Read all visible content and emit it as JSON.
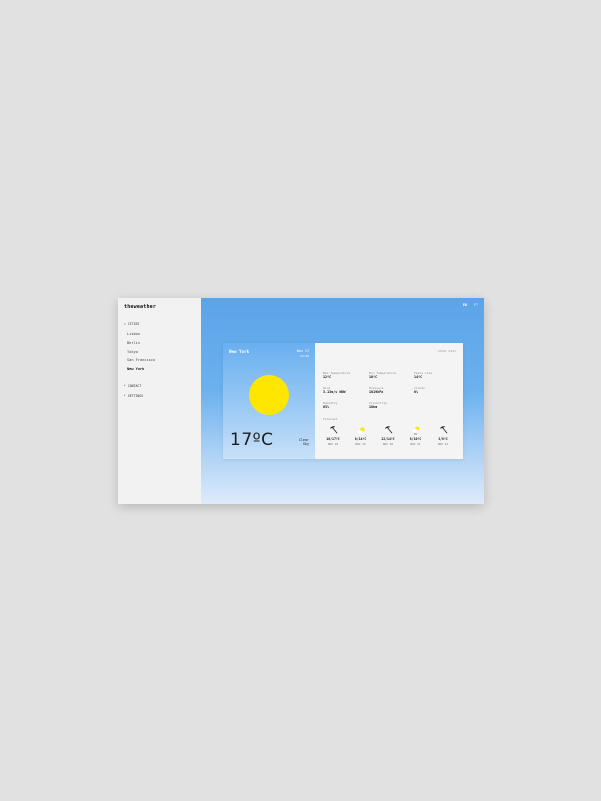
{
  "app": {
    "brand": "theweather"
  },
  "sidebar": {
    "sections": {
      "cities": "CITIES",
      "contact": "CONTACT",
      "settings": "SETTINGS"
    },
    "cities": [
      "Lisbon",
      "Berlin",
      "Tokyo",
      "San Francisco",
      "New York"
    ],
    "active_city": "New York"
  },
  "top_controls": {
    "option1": "EN",
    "option2": "PT"
  },
  "current": {
    "location": "New York",
    "date": "Nov 17",
    "time": "13:46",
    "temperature": "17ºC",
    "description_line1": "Clear",
    "description_line2": "Sky",
    "icon": "sun-icon"
  },
  "details": {
    "units_toggle": "SHOW UNIT",
    "stats": [
      {
        "label": "Max Temperature",
        "value": "12ºC"
      },
      {
        "label": "Min Temperature",
        "value": "10ºC"
      },
      {
        "label": "Feels Like",
        "value": "14ºC"
      },
      {
        "label": "Wind",
        "value": "3.13m/s NNW"
      },
      {
        "label": "Pressure",
        "value": "1019hPa"
      },
      {
        "label": "Clouds",
        "value": "0%"
      },
      {
        "label": "Humidity",
        "value": "63%"
      },
      {
        "label": "Visibility",
        "value": "10km"
      }
    ],
    "forecast_label": "Forecast",
    "forecast": [
      {
        "temps": "10/17ºC",
        "day": "NOV 18",
        "icon": "umbrella-icon",
        "rain": ""
      },
      {
        "temps": "8/14ºC",
        "day": "NOV 19",
        "icon": "sun-cloud-icon",
        "rain": ""
      },
      {
        "temps": "12/14ºC",
        "day": "NOV 20",
        "icon": "umbrella-icon",
        "rain": ""
      },
      {
        "temps": "8/10ºC",
        "day": "NOV 21",
        "icon": "sun-cloud-icon",
        "rain": "0%"
      },
      {
        "temps": "3/8ºC",
        "day": "NOV 22",
        "icon": "umbrella-icon",
        "rain": ""
      }
    ]
  },
  "colors": {
    "sun": "#ffe600",
    "sky_top": "#5ba4e8",
    "sky_bottom": "#dfeafb",
    "sidebar_bg": "#f2f2f2"
  }
}
